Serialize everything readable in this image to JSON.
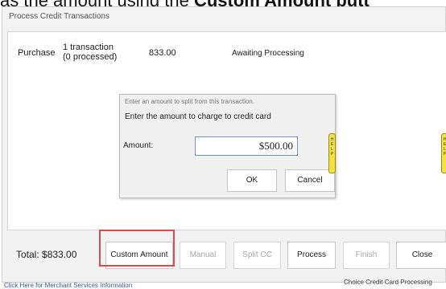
{
  "caption": {
    "prefix": "as the amount using the ",
    "bold": "Custom Amount",
    "suffix": " butt"
  },
  "window": {
    "title": "Process Credit Transactions"
  },
  "transaction_row": {
    "type": "Purchase",
    "count_line1": "1 transaction",
    "count_line2": "(0 processed)",
    "amount": "833.00",
    "status": "Awaiting Processing"
  },
  "dialog": {
    "title": "Enter an amount to split from this transaction.",
    "prompt": "Enter the amount to charge to credit card",
    "amount_label": "Amount:",
    "amount_value": "$500.00",
    "ok_label": "OK",
    "cancel_label": "Cancel"
  },
  "help_tab": {
    "text": "HELP"
  },
  "footer": {
    "total": "Total: $833.00",
    "buttons": {
      "custom_amount": "Custom Amount",
      "manual": "Manual",
      "split_cc": "Split CC",
      "process": "Process",
      "finish": "Finish",
      "close": "Close"
    },
    "merchant_link": "Click Here for Merchant Services Information",
    "provider": "Choice Credit Card Processing"
  },
  "colors": {
    "highlight": "#d84c4c",
    "help_tab": "#f5e23a",
    "link": "#2a5db0"
  }
}
